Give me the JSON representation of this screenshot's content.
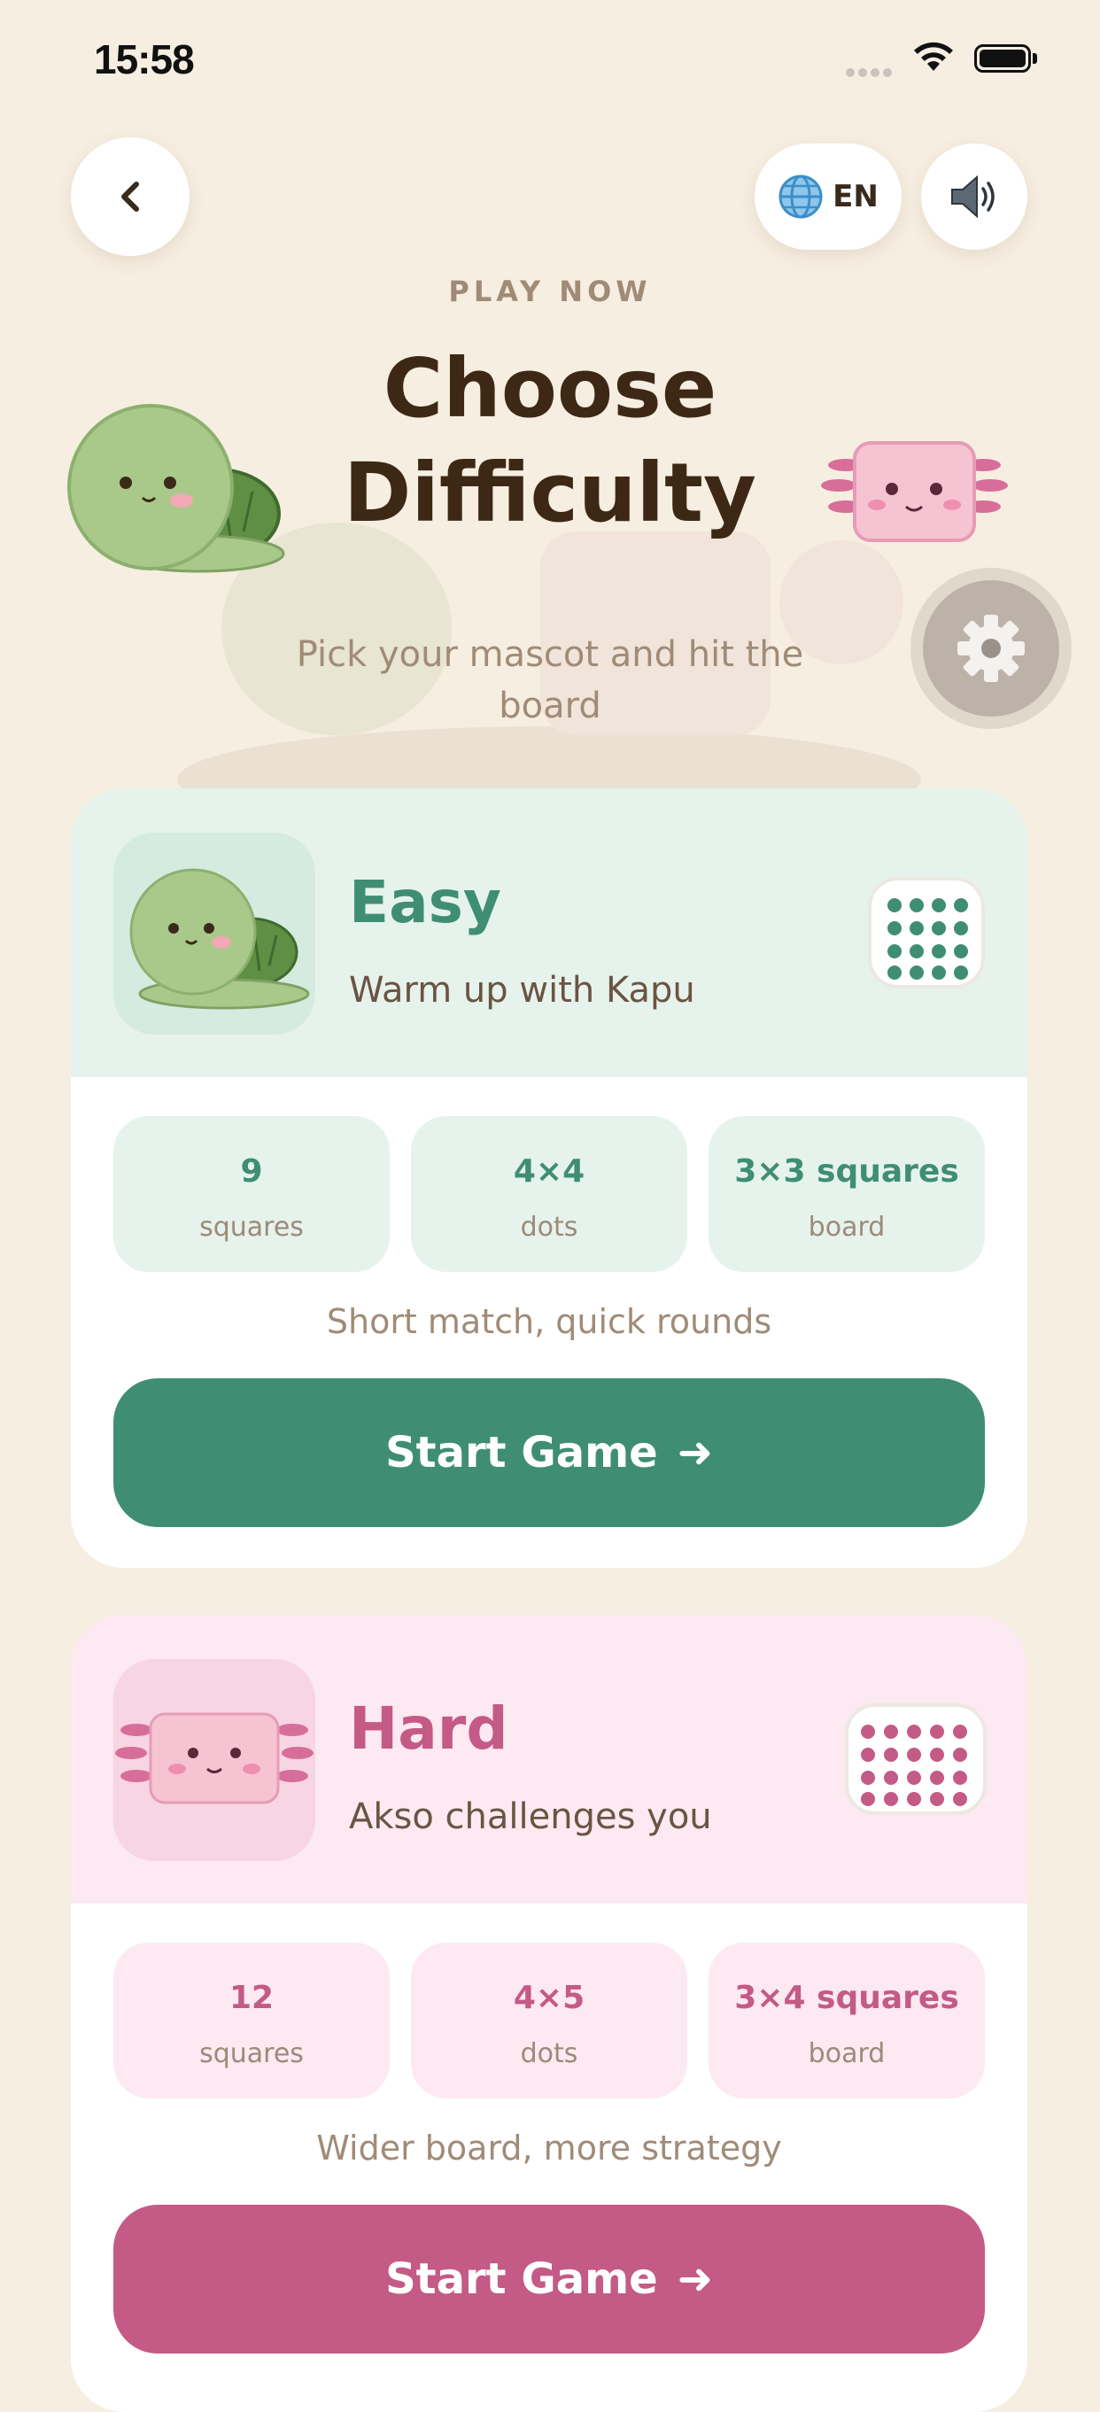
{
  "status_bar": {
    "time": "15:58"
  },
  "header": {
    "language": "EN",
    "eyebrow": "PLAY NOW",
    "title_line1": "Choose",
    "title_line2": "Difficulty",
    "subtitle": "Pick your mascot and hit the board"
  },
  "levels": [
    {
      "name": "Easy",
      "tagline": "Warm up with Kapu",
      "stats": [
        {
          "value": "9",
          "label": "squares"
        },
        {
          "value": "4×4",
          "label": "dots"
        },
        {
          "value": "3×3 squares",
          "label": "board"
        }
      ],
      "blurb": "Short match, quick rounds",
      "button": "Start Game",
      "color": "#3F8E74"
    },
    {
      "name": "Hard",
      "tagline": "Akso challenges you",
      "stats": [
        {
          "value": "12",
          "label": "squares"
        },
        {
          "value": "4×5",
          "label": "dots"
        },
        {
          "value": "3×4 squares",
          "label": "board"
        }
      ],
      "blurb": "Wider board, more strategy",
      "button": "Start Game",
      "color": "#C45A86"
    }
  ],
  "icons": {
    "back": "chevron-left-icon",
    "language": "globe-icon",
    "sound": "speaker-icon",
    "settings": "gear-icon",
    "start": "arrow-right-icon"
  },
  "colors": {
    "background": "#F6EEE1",
    "easy": "#3F8E74",
    "hard": "#C45A86"
  }
}
